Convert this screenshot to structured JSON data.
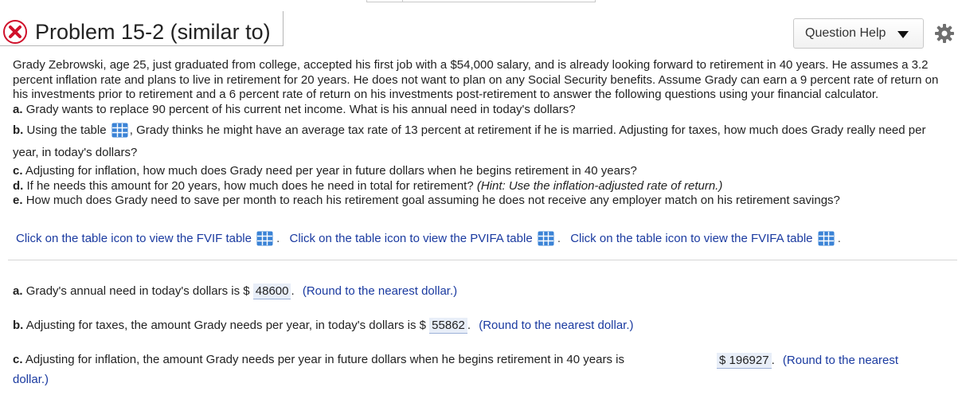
{
  "header": {
    "title": "Problem 15-2 (similar to)",
    "help_label": "Question Help",
    "status_icon": "incorrect-x-icon",
    "colors": {
      "error_red": "#d0112b",
      "link_blue": "#1a3aa0",
      "answer_bg": "#e8eef8"
    }
  },
  "problem": {
    "intro": "Grady Zebrowski, age 25, just graduated from college, accepted his first job with a $54,000 salary, and is already looking forward to retirement in 40 years. He assumes a 3.2 percent inflation rate and plans to live in retirement for 20 years. He does not want to plan on any Social Security benefits. Assume Grady can earn a 9 percent rate of return on his investments prior to retirement and a 6 percent rate of return on his investments post-retirement to answer the following questions using your financial calculator.",
    "a_label": "a.",
    "a_text": "Grady wants to replace 90 percent of his current net income. What is his annual need in today's dollars?",
    "b_label": "b.",
    "b_text_1": "Using the table",
    "b_text_2": ", Grady thinks he might have an average tax rate of 13 percent at retirement if he is married. Adjusting for taxes, how much does Grady really need per year, in today's dollars?",
    "c_label": "c.",
    "c_text": "Adjusting for inflation, how much does Grady need per year in future dollars when he begins retirement in 40 years?",
    "d_label": "d.",
    "d_text": "If he needs this amount for 20 years, how much does he need in total for retirement?",
    "d_hint": "(Hint: Use the inflation-adjusted rate of return.)",
    "e_label": "e.",
    "e_text": "How much does Grady need to save per month to reach his retirement goal assuming he does not receive any employer match on his retirement savings?"
  },
  "links": {
    "fvif": "Click on the table icon to view the FVIF table",
    "pvifa": "Click on the table icon to view the PVIFA table",
    "fvifa": "Click on the table icon to view the FVIFA table",
    "sep": "."
  },
  "answers": {
    "a_label": "a.",
    "a_text": "Grady's annual need in today's dollars is $",
    "a_value": "48600",
    "a_hint": "(Round to the nearest dollar.)",
    "b_label": "b.",
    "b_text": "Adjusting for taxes, the amount Grady needs per year, in today's dollars is $",
    "b_value": "55862",
    "b_hint": "(Round to the nearest dollar.)",
    "c_label": "c.",
    "c_text": "Adjusting for inflation, the amount Grady needs per year in future dollars when he begins retirement in 40 years is",
    "c_currency": "$",
    "c_value": "196927",
    "c_hint_1": "(Round to the nearest",
    "c_hint_2": "dollar.)",
    "period": "."
  }
}
